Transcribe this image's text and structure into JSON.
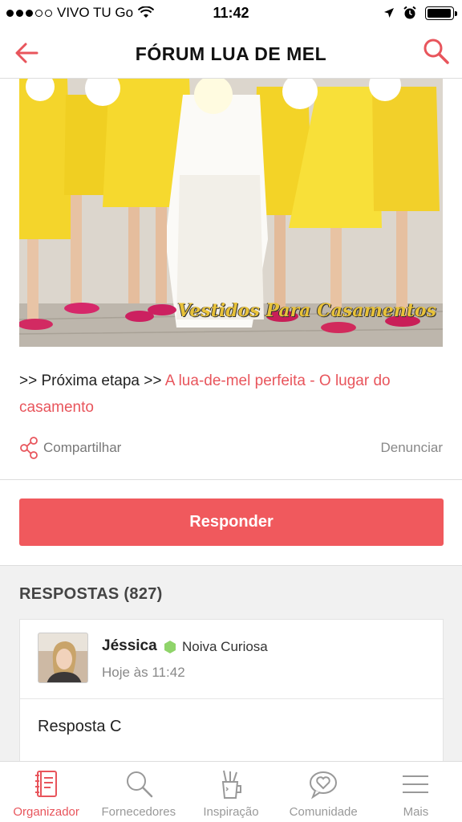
{
  "status_bar": {
    "carrier": "VIVO TU Go",
    "time": "11:42",
    "battery_level": 0.95
  },
  "nav": {
    "title": "FÓRUM LUA DE MEL",
    "back_icon": "arrow-left-icon",
    "search_icon": "search-icon"
  },
  "hero": {
    "watermark": "Vestidos Para Casamentos"
  },
  "next_step": {
    "prefix": ">> Próxima etapa >> ",
    "link": "A lua-de-mel perfeita - O lugar do casamento"
  },
  "actions": {
    "share_label": "Compartilhar",
    "report_label": "Denunciar"
  },
  "reply_button": "Responder",
  "answers": {
    "title": "RESPOSTAS (827)",
    "items": [
      {
        "author": "Jéssica",
        "level": "Noiva Curiosa",
        "time": "Hoje às 11:42",
        "text": "Resposta C"
      }
    ]
  },
  "tabs": [
    {
      "label": "Organizador",
      "icon": "notebook-icon",
      "active": true
    },
    {
      "label": "Fornecedores",
      "icon": "search-icon",
      "active": false
    },
    {
      "label": "Inspiração",
      "icon": "pencil-cup-icon",
      "active": false
    },
    {
      "label": "Comunidade",
      "icon": "heart-bubble-icon",
      "active": false
    },
    {
      "label": "Mais",
      "icon": "menu-icon",
      "active": false
    }
  ],
  "colors": {
    "accent": "#f0595d",
    "link": "#e8555c",
    "level_badge": "#8fd46a"
  }
}
